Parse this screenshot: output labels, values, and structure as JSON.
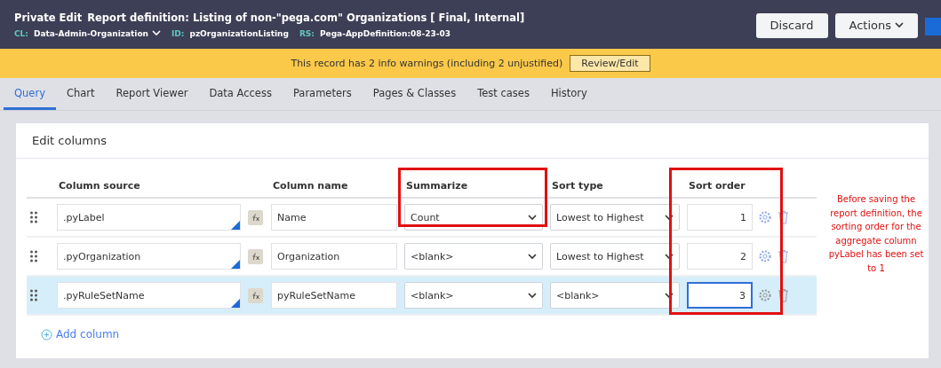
{
  "header": {
    "mode": "Private Edit",
    "title": "Report definition: Listing of non-\"pega.com\" Organizations [ **Final**, Internal]",
    "meta": [
      {
        "label": "CL:",
        "value": "Data-Admin-Organization",
        "dropdown": true
      },
      {
        "label": "ID:",
        "value": "pzOrganizationListing",
        "dropdown": false
      },
      {
        "label": "RS:",
        "value": "Pega-AppDefinition:08-23-03",
        "dropdown": false
      }
    ],
    "buttons": [
      {
        "label": "Discard",
        "dropdown": false
      },
      {
        "label": "Actions",
        "dropdown": true
      }
    ]
  },
  "warning": {
    "text": "This record has 2 info warnings (including 2 unjustified)",
    "button": "Review/Edit"
  },
  "tabs": [
    {
      "label": "Query",
      "selected": true
    },
    {
      "label": "Chart",
      "selected": false
    },
    {
      "label": "Report Viewer",
      "selected": false
    },
    {
      "label": "Data Access",
      "selected": false
    },
    {
      "label": "Parameters",
      "selected": false
    },
    {
      "label": "Pages & Classes",
      "selected": false
    },
    {
      "label": "Test cases",
      "selected": false
    },
    {
      "label": "History",
      "selected": false
    }
  ],
  "section": {
    "title": "Edit columns",
    "columns": [
      "Column source",
      "Column name",
      "Summarize",
      "Sort type",
      "Sort order"
    ],
    "rows": [
      {
        "source": ".pyLabel",
        "name": "Name",
        "summarize": "Count",
        "sort_type": "Lowest to Highest",
        "sort_order": "1",
        "selected": false,
        "focused": false
      },
      {
        "source": ".pyOrganization",
        "name": "Organization",
        "summarize": "<blank>",
        "sort_type": "Lowest to Highest",
        "sort_order": "2",
        "selected": false,
        "focused": false
      },
      {
        "source": ".pyRuleSetName",
        "name": "pyRuleSetName",
        "summarize": "<blank>",
        "sort_type": "<blank>",
        "sort_order": "3",
        "selected": true,
        "focused": true
      }
    ],
    "add_link": "Add column"
  },
  "annotation": "Before saving the report definition, the sorting order for the aggregate column pyLabel has been set to 1"
}
